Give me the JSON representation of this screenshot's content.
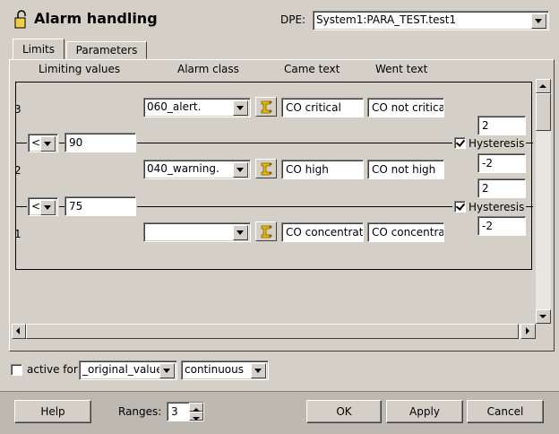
{
  "window": {
    "title": "Alarm handling"
  },
  "dpe": {
    "label": "DPE:",
    "value": "System1:PARA_TEST.test1"
  },
  "tabs": [
    {
      "label": "Limits"
    },
    {
      "label": "Parameters"
    }
  ],
  "headers": {
    "limiting_values": "Limiting values",
    "alarm_class": "Alarm class",
    "came_text": "Came text",
    "went_text": "Went text"
  },
  "ranges": [
    {
      "index": "3",
      "alarm_class": "060_alert.",
      "came": "CO critical",
      "went": "CO not critical"
    },
    {
      "index": "2",
      "alarm_class": "040_warning.",
      "came": "CO high",
      "went": "CO not high"
    },
    {
      "index": "1",
      "alarm_class": "",
      "came": "CO concentration",
      "went": "CO concentration"
    }
  ],
  "limits": [
    {
      "operator": "<",
      "value": "90",
      "hysteresis_label": "Hysteresis",
      "hysteresis_checked": true,
      "upper": "2",
      "lower": "-2"
    },
    {
      "operator": "<",
      "value": "75",
      "hysteresis_label": "Hysteresis",
      "hysteresis_checked": true,
      "upper": "2",
      "lower": "-2"
    }
  ],
  "active_for": {
    "label": "active for",
    "checked": false,
    "value_option": "_original_value",
    "mode_option": "continuous"
  },
  "footer": {
    "help": "Help",
    "ranges_label": "Ranges:",
    "ranges_value": "3",
    "ok": "OK",
    "apply": "Apply",
    "cancel": "Cancel"
  },
  "colors": {
    "background": "#d4d0c8",
    "field": "#ffffff",
    "class_icon": "#e8b800"
  },
  "icons": {
    "window": "lock-icon",
    "class_picker": "alarm-class-icon"
  }
}
